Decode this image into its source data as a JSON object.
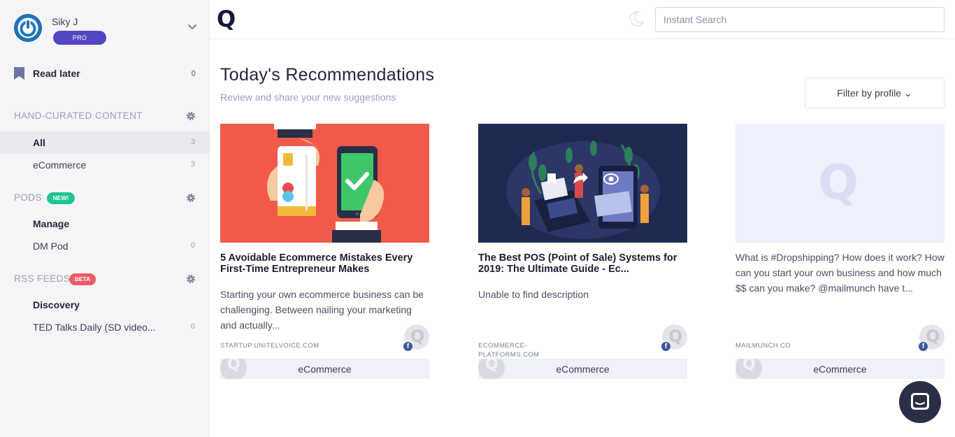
{
  "profile": {
    "name": "Siky J",
    "badge": "PRO"
  },
  "read_later": {
    "label": "Read later",
    "count": "0"
  },
  "sections": {
    "hand_curated": {
      "label": "HAND-CURATED CONTENT",
      "items": [
        {
          "label": "All",
          "count": "3"
        },
        {
          "label": "eCommerce",
          "count": "3"
        }
      ]
    },
    "pods": {
      "label": "PODS",
      "tag": "NEW!",
      "items": [
        {
          "label": "Manage"
        },
        {
          "label": "DM Pod",
          "count": "0"
        }
      ]
    },
    "rss": {
      "label": "RSS FEEDS",
      "tag": "BETA",
      "items": [
        {
          "label": "Discovery"
        },
        {
          "label": "TED Talks Daily (SD video...",
          "count": "0"
        }
      ]
    }
  },
  "header": {
    "logo": "Q",
    "search_placeholder": "Instant Search"
  },
  "main": {
    "title": "Today's Recommendations",
    "subtitle": "Review and share your new suggestions",
    "filter_label": "Filter by profile ⌄"
  },
  "cards": [
    {
      "title": "5 Avoidable Ecommerce Mistakes Every First-Time Entrepreneur Makes",
      "description": "Starting your own ecommerce business can be challenging. Between nailing your marketing and actually...",
      "source": "STARTUP.UNITELVOICE.COM",
      "tag": "eCommerce"
    },
    {
      "title": "The Best POS (Point of Sale) Systems for 2019: The Ultimate Guide - Ec...",
      "description": "Unable to find description",
      "source": "ECOMMERCE-PLATFORMS.COM",
      "tag": "eCommerce"
    },
    {
      "title": "",
      "description": "What is #Dropshipping? How does it work? How can you start your own business and how much $$ can you make? @mailmunch have t...",
      "source": "MAILMUNCH.CO",
      "tag": "eCommerce"
    }
  ],
  "colors": {
    "accent": "#5147c2",
    "new_tag": "#1fc495",
    "beta_tag": "#ef5b66",
    "card1_bg": "#f15a4a",
    "card2_bg": "#1f2a52"
  }
}
